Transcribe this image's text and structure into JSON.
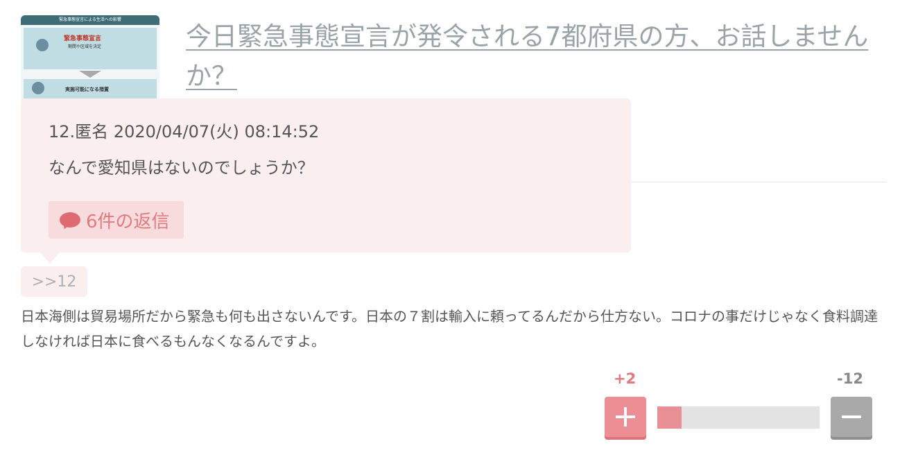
{
  "thumbnail": {
    "band_text": "緊急事態宣言による生活への影響",
    "headline": "緊急事態宣言",
    "subline": "期間や区域を決定",
    "step_title": "実施可能になる措置"
  },
  "title": "今日緊急事態宣言が発令される7都府県の方、お話しませんか？",
  "popup": {
    "meta": "12.匿名 2020/04/07(火) 08:14:52",
    "body": "なんで愛知県はないのでしょうか？",
    "reply_label": "6件の返信"
  },
  "anchor_label": ">>12",
  "comment_text": "日本海側は貿易場所だから緊急も何も出さないんです。日本の７割は輸入に頼ってるんだから仕方ない。コロナの事だけじゃなく食料調達しなければ日本に食べるもんなくなるんですよ。",
  "votes": {
    "plus": "+2",
    "minus": "-12",
    "plus_ratio": 0.15
  },
  "colors": {
    "accent": "#e07a80",
    "popup_bg": "#fbeeee",
    "title": "#9aa4a8"
  }
}
